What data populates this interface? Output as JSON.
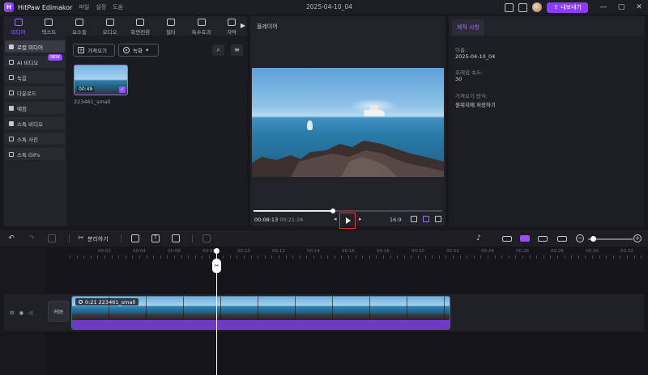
{
  "app": {
    "name": "HitPaw Edimakor",
    "window_title": "2025-04-10_04",
    "menu": [
      "파일",
      "설정",
      "도움"
    ],
    "export_label": "내보내기"
  },
  "toolbar_tabs": [
    "미디어",
    "텍스트",
    "요소들",
    "오디오",
    "화면전환",
    "필터",
    "특수효과",
    "자막"
  ],
  "side_nav": [
    {
      "label": "로컬 미디어",
      "active": true
    },
    {
      "label": "AI 비디오",
      "badge": "NEW"
    },
    {
      "label": "녹음"
    },
    {
      "label": "다운로드"
    },
    {
      "label": "예컴"
    },
    {
      "label": "스톡 비디오"
    },
    {
      "label": "스톡 사진"
    },
    {
      "label": "스톡 GIFs"
    }
  ],
  "media": {
    "import_label": "가져오기",
    "record_label": "녹화",
    "clip": {
      "duration": "00:49",
      "name": "223461_small"
    }
  },
  "player": {
    "title": "플레이어",
    "time_current": "00:08:13",
    "time_total": "/ 00:21:26",
    "ratio": "16:9",
    "progress": 0.42
  },
  "properties": {
    "tab": "제작 사항",
    "fields": [
      {
        "label": "이름:",
        "value": "2025-04-10_04"
      },
      {
        "label": "프레임 속도:",
        "value": "30"
      },
      {
        "label": "가져오기 방식:",
        "value": "원위치에 저장하기"
      }
    ]
  },
  "timeline": {
    "split_label": "분리하기",
    "ruler": [
      "00:02",
      "00:04",
      "00:06",
      "00:08",
      "00:10",
      "00:12",
      "00:14",
      "00:16",
      "00:18",
      "00:20",
      "00:22",
      "00:24",
      "00:26",
      "00:28",
      "00:30",
      "00:32"
    ],
    "cover_label": "커버",
    "clip_label": "0:21 223461_small",
    "zoom": 0.1
  },
  "colors": {
    "accent": "#9b4cff",
    "highlight": "#e43b3b"
  }
}
